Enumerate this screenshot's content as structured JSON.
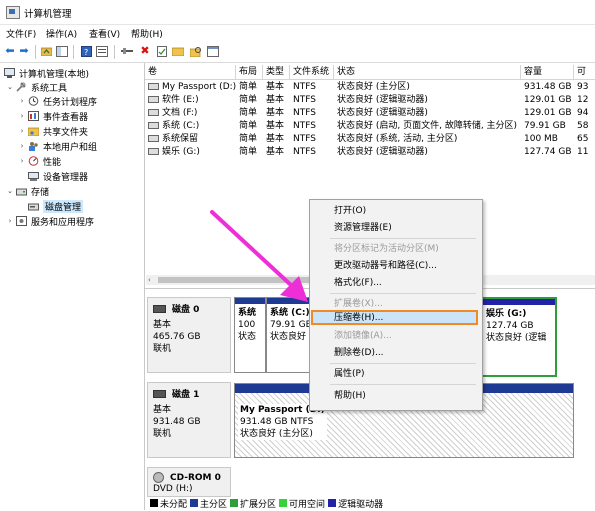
{
  "window": {
    "title": "计算机管理"
  },
  "menu": [
    "文件(F)",
    "操作(A)",
    "查看(V)",
    "帮助(H)"
  ],
  "tree": [
    {
      "label": "计算机管理(本地)",
      "icon": "computer-management-icon"
    },
    {
      "label": "系统工具",
      "icon": "system-tools-icon"
    },
    {
      "label": "任务计划程序",
      "icon": "clock-icon"
    },
    {
      "label": "事件查看器",
      "icon": "event-viewer-icon"
    },
    {
      "label": "共享文件夹",
      "icon": "shared-folder-icon"
    },
    {
      "label": "本地用户和组",
      "icon": "users-icon"
    },
    {
      "label": "性能",
      "icon": "performance-icon"
    },
    {
      "label": "设备管理器",
      "icon": "device-manager-icon"
    },
    {
      "label": "存储",
      "icon": "storage-icon"
    },
    {
      "label": "磁盘管理",
      "icon": "disk-management-icon"
    },
    {
      "label": "服务和应用程序",
      "icon": "services-icon"
    }
  ],
  "columns": [
    "卷",
    "布局",
    "类型",
    "文件系统",
    "状态",
    "容量",
    "可"
  ],
  "volumes": [
    {
      "name": "My Passport (D:)",
      "layout": "简单",
      "type": "基本",
      "fs": "NTFS",
      "status": "状态良好 (主分区)",
      "capacity": "931.48 GB",
      "free": "93"
    },
    {
      "name": "软件 (E:)",
      "layout": "简单",
      "type": "基本",
      "fs": "NTFS",
      "status": "状态良好 (逻辑驱动器)",
      "capacity": "129.01 GB",
      "free": "12"
    },
    {
      "name": "文档 (F:)",
      "layout": "简单",
      "type": "基本",
      "fs": "NTFS",
      "status": "状态良好 (逻辑驱动器)",
      "capacity": "129.01 GB",
      "free": "94"
    },
    {
      "name": "系统 (C:)",
      "layout": "简单",
      "type": "基本",
      "fs": "NTFS",
      "status": "状态良好 (启动, 页面文件, 故障转储, 主分区)",
      "capacity": "79.91 GB",
      "free": "58"
    },
    {
      "name": "系统保留",
      "layout": "简单",
      "type": "基本",
      "fs": "NTFS",
      "status": "状态良好 (系统, 活动, 主分区)",
      "capacity": "100 MB",
      "free": "65"
    },
    {
      "name": "娱乐 (G:)",
      "layout": "简单",
      "type": "基本",
      "fs": "NTFS",
      "status": "状态良好 (逻辑驱动器)",
      "capacity": "127.74 GB",
      "free": "11"
    }
  ],
  "disks": {
    "disk0": {
      "name": "磁盘 0",
      "type": "基本",
      "size": "465.76 GB",
      "state": "联机"
    },
    "disk1": {
      "name": "磁盘 1",
      "type": "基本",
      "size": "931.48 GB",
      "state": "联机"
    },
    "cdrom": {
      "name": "CD-ROM 0",
      "type": "DVD (H:)"
    }
  },
  "partitions": {
    "reserved": {
      "l1": "系统",
      "l2": "100",
      "l3": "状态"
    },
    "c": {
      "l1": "系统 (C:)",
      "l2": "79.91 GB",
      "l3": "状态良好"
    },
    "g": {
      "l1": "娱乐 (G:)",
      "l2": "127.74 GB",
      "l3": "状态良好 (逻辑"
    },
    "passport": {
      "l1": "My Passport (D:)",
      "l2": "931.48 GB NTFS",
      "l3": "状态良好 (主分区)"
    }
  },
  "legend": [
    {
      "label": "未分配",
      "color": "#000000"
    },
    {
      "label": "主分区",
      "color": "#1f3a93"
    },
    {
      "label": "扩展分区",
      "color": "#2e9e3a"
    },
    {
      "label": "可用空间",
      "color": "#36d13c"
    },
    {
      "label": "逻辑驱动器",
      "color": "#2323a8"
    }
  ],
  "context_menu": {
    "open": "打开(O)",
    "explorer": "资源管理器(E)",
    "mark_active": "将分区标记为活动分区(M)",
    "change_letter": "更改驱动器号和路径(C)...",
    "format": "格式化(F)...",
    "extend": "扩展卷(X)...",
    "shrink": "压缩卷(H)...",
    "add_mirror": "添加镜像(A)...",
    "delete": "删除卷(D)...",
    "properties": "属性(P)",
    "help": "帮助(H)"
  },
  "colors": {
    "highlight_border": "#f08a24",
    "primary_bar": "#1f3a93",
    "logical_bar": "#2323a8",
    "extended_border": "#2e9e3a",
    "arrow": "#ee2fd8"
  }
}
